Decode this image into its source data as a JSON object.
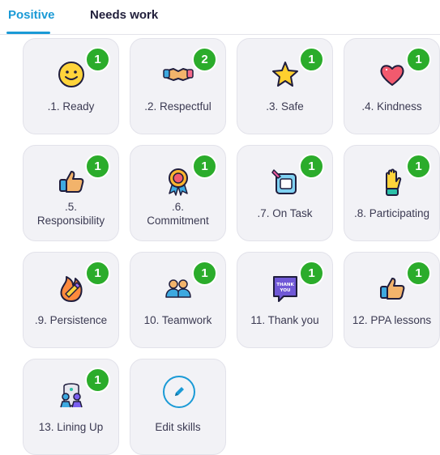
{
  "tabs": [
    {
      "label": "Positive",
      "active": true
    },
    {
      "label": "Needs work",
      "active": false
    }
  ],
  "skills": [
    {
      "label": ".1. Ready",
      "count": "1",
      "icon": "smiley-face-icon"
    },
    {
      "label": ".2. Respectful",
      "count": "2",
      "icon": "handshake-icon"
    },
    {
      "label": ".3. Safe",
      "count": "1",
      "icon": "star-icon"
    },
    {
      "label": ".4. Kindness",
      "count": "1",
      "icon": "heart-icon"
    },
    {
      "label_line1": ".5.",
      "label_line2": "Responsibility",
      "count": "1",
      "icon": "thumbs-up-icon"
    },
    {
      "label_line1": ".6.",
      "label_line2": "Commitment",
      "count": "1",
      "icon": "award-ribbon-icon"
    },
    {
      "label": ".7. On Task",
      "count": "1",
      "icon": "task-pencil-icon"
    },
    {
      "label": ".8. Participating",
      "count": "1",
      "icon": "raised-hand-icon"
    },
    {
      "label": ".9. Persistence",
      "count": "1",
      "icon": "pencil-flame-icon"
    },
    {
      "label": "10. Teamwork",
      "count": "1",
      "icon": "teamwork-icon"
    },
    {
      "label": "11. Thank you",
      "count": "1",
      "icon": "thank-you-sign-icon",
      "icon_text": "THANK YOU"
    },
    {
      "label": "12. PPA lessons",
      "count": "1",
      "icon": "thumbs-up-icon"
    },
    {
      "label": "13. Lining Up",
      "count": "1",
      "icon": "lining-up-icon"
    }
  ],
  "edit": {
    "label": "Edit skills",
    "icon": "pencil-icon"
  },
  "colors": {
    "accent": "#1a9ad6",
    "badge": "#2bac2b",
    "card": "#f2f2f6"
  }
}
